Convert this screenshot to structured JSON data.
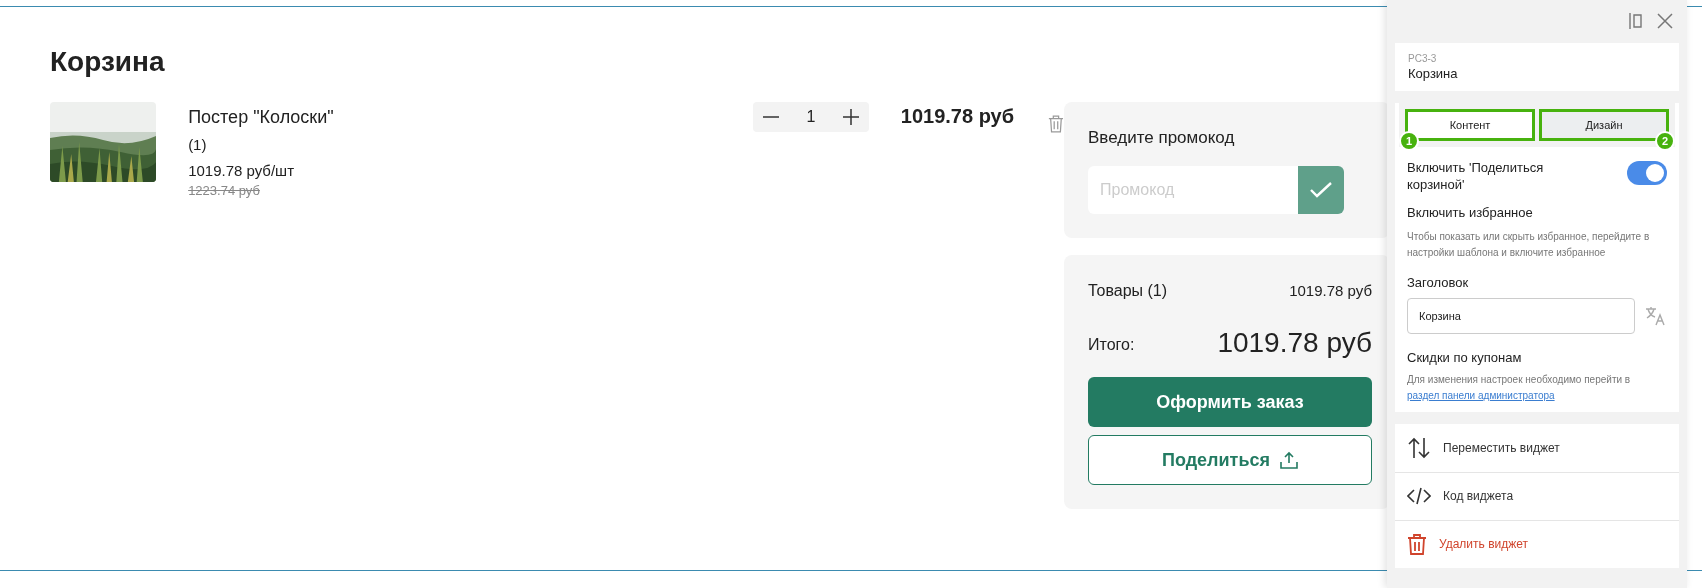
{
  "page": {
    "title": "Корзина"
  },
  "cart_items": [
    {
      "name": "Постер \"Колоски\"",
      "variant": "(1)",
      "unit_price": "1019.78 руб/шт",
      "old_price": "1223.74 руб",
      "quantity": "1",
      "total": "1019.78 руб"
    }
  ],
  "promo": {
    "title": "Введите промокод",
    "placeholder": "Промокод"
  },
  "summary": {
    "items_label": "Товары (1)",
    "items_total": "1019.78 руб",
    "total_label": "Итого:",
    "total": "1019.78 руб",
    "checkout_button": "Оформить заказ",
    "share_button": "Поделиться"
  },
  "panel": {
    "widget_id": "PC3-3",
    "widget_name": "Корзина",
    "tabs": [
      {
        "label": "Контент",
        "selected": true,
        "badge": "1"
      },
      {
        "label": "Дизайн",
        "selected": false,
        "badge": "2"
      }
    ],
    "share_toggle": {
      "label": "Включить 'Поделиться корзиной'",
      "on": true
    },
    "favorites": {
      "title": "Включить избранное",
      "hint": "Чтобы показать или скрыть избранное, перейдите в настройки шаблона и включите избранное"
    },
    "heading_field": {
      "label": "Заголовок",
      "value": "Корзина"
    },
    "coupons": {
      "title": "Скидки по купонам",
      "hint": "Для изменения настроек необходимо перейти в",
      "link": "раздел панели администратора"
    },
    "actions": [
      {
        "kind": "move",
        "label": "Переместить виджет"
      },
      {
        "kind": "code",
        "label": "Код виджета"
      },
      {
        "kind": "delete",
        "label": "Удалить виджет"
      }
    ]
  }
}
